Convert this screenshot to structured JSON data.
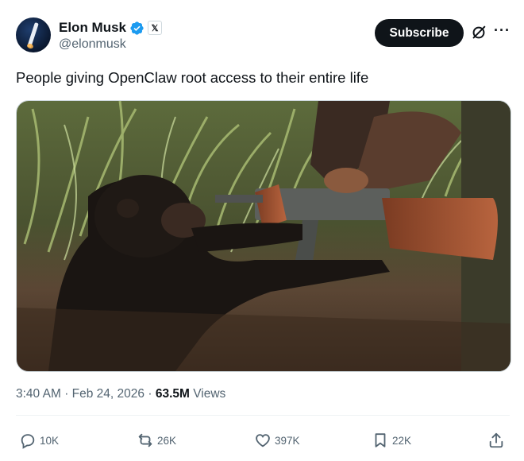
{
  "author": {
    "name": "Elon Musk",
    "handle": "@elonmusk",
    "verified_icon": "verified-badge-icon",
    "affiliate_icon": "x-logo-icon",
    "x_badge_glyph": "𝕏"
  },
  "subscribe_label": "Subscribe",
  "tweet_text": "People giving OpenClaw root access to their entire life",
  "meta": {
    "time": "3:40 AM",
    "date": "Feb 24, 2026",
    "views_count": "63.5M",
    "views_label": "Views",
    "dot": "·"
  },
  "actions": {
    "replies": "10K",
    "reposts": "26K",
    "likes": "397K",
    "bookmarks": "22K"
  },
  "more_glyph": "···",
  "colors": {
    "accent": "#1d9bf0",
    "text": "#0f1419",
    "secondary": "#536471",
    "button_bg": "#0f1419"
  }
}
